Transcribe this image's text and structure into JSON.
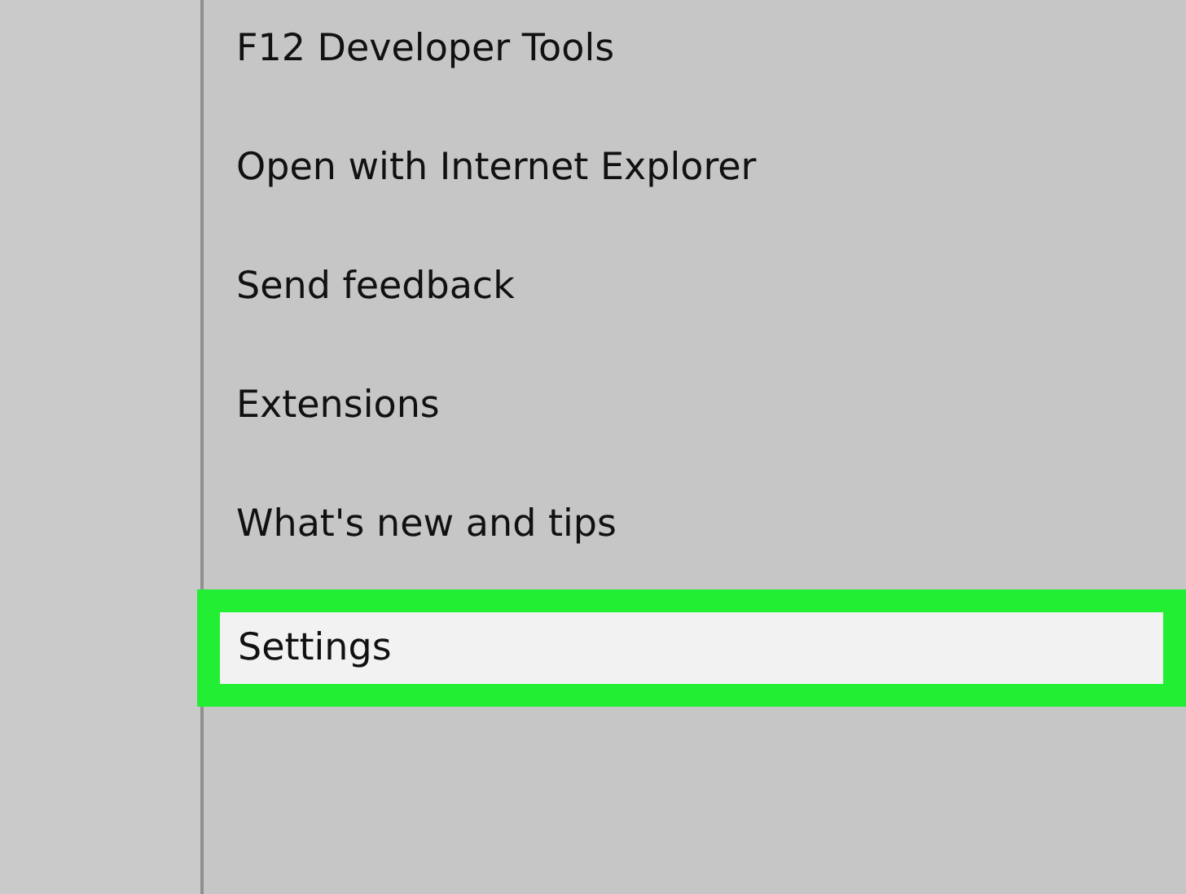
{
  "menu": {
    "items": [
      {
        "label": "F12 Developer Tools",
        "selected": false
      },
      {
        "label": "Open with Internet Explorer",
        "selected": false
      },
      {
        "label": "Send feedback",
        "selected": false
      },
      {
        "label": "Extensions",
        "selected": false
      },
      {
        "label": "What's new and tips",
        "selected": false
      },
      {
        "label": "Settings",
        "selected": true
      }
    ]
  }
}
